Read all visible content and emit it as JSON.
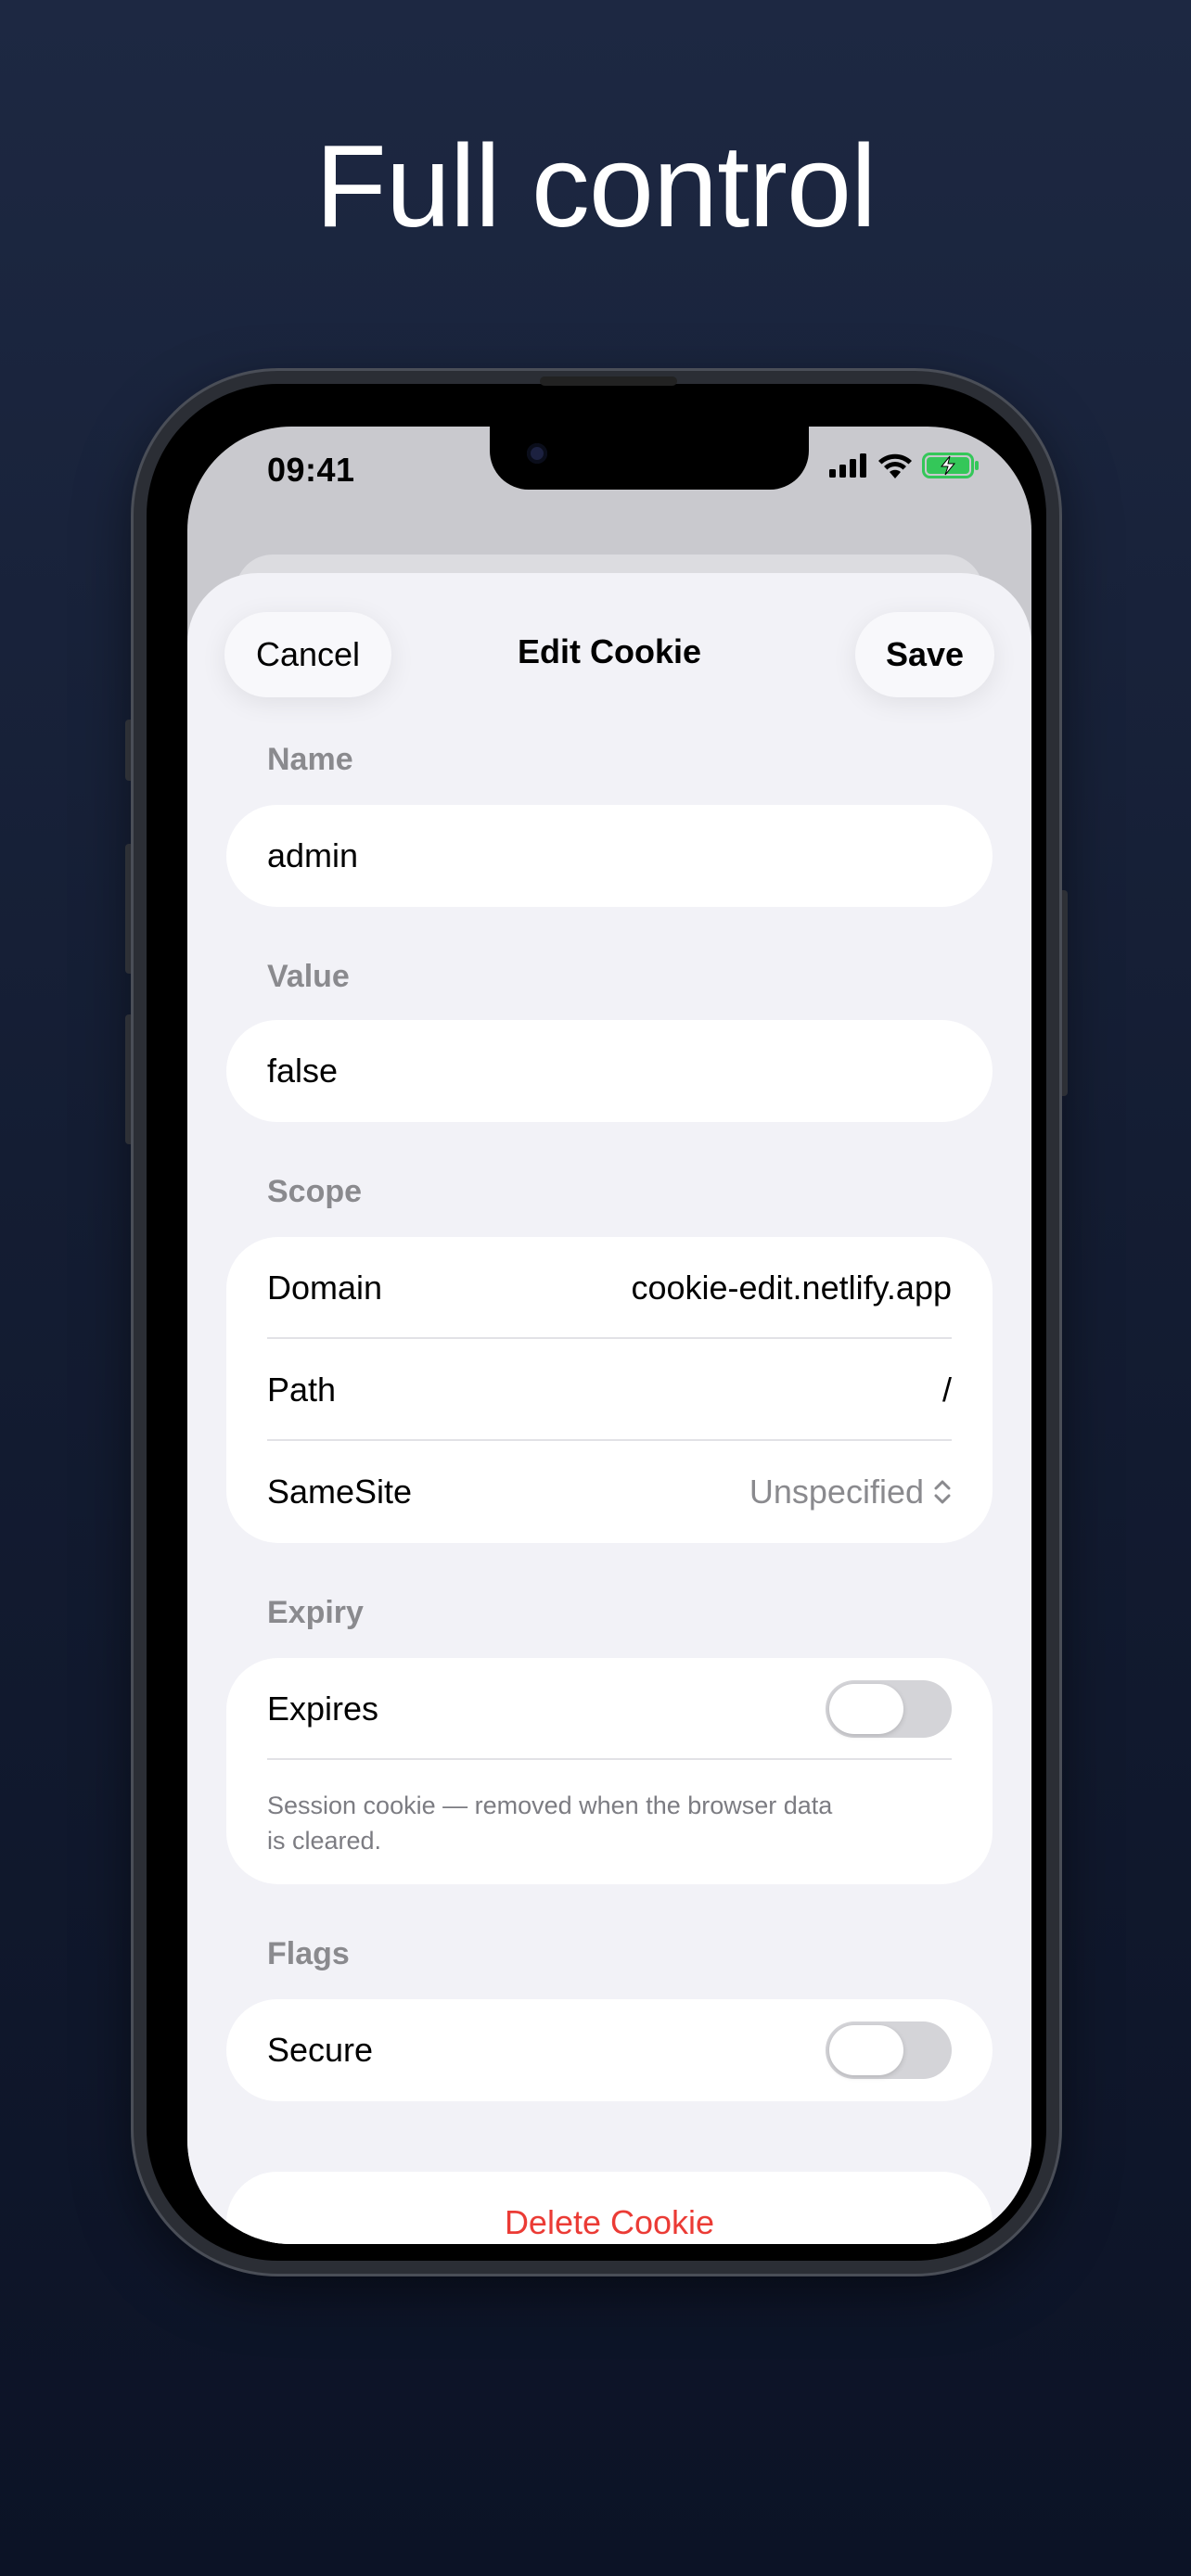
{
  "headline": "Full control",
  "status": {
    "time": "09:41"
  },
  "sheet": {
    "title": "Edit Cookie",
    "cancel_label": "Cancel",
    "save_label": "Save"
  },
  "name": {
    "label": "Name",
    "value": "admin"
  },
  "value": {
    "label": "Value",
    "value": "false"
  },
  "scope": {
    "label": "Scope",
    "domain_label": "Domain",
    "domain_value": "cookie-edit.netlify.app",
    "path_label": "Path",
    "path_value": "/",
    "samesite_label": "SameSite",
    "samesite_value": "Unspecified"
  },
  "expiry": {
    "label": "Expiry",
    "expires_label": "Expires",
    "expires_on": false,
    "note_line1": "Session cookie — removed when the browser data",
    "note_line2": "is cleared."
  },
  "flags": {
    "label": "Flags",
    "secure_label": "Secure",
    "secure_on": false
  },
  "delete_label": "Delete Cookie",
  "colors": {
    "background": "#1a2440",
    "destructive": "#eb3b35",
    "battery": "#34c759"
  },
  "icons": [
    "signal-icon",
    "wifi-icon",
    "battery-icon",
    "chevron-updown-icon"
  ]
}
